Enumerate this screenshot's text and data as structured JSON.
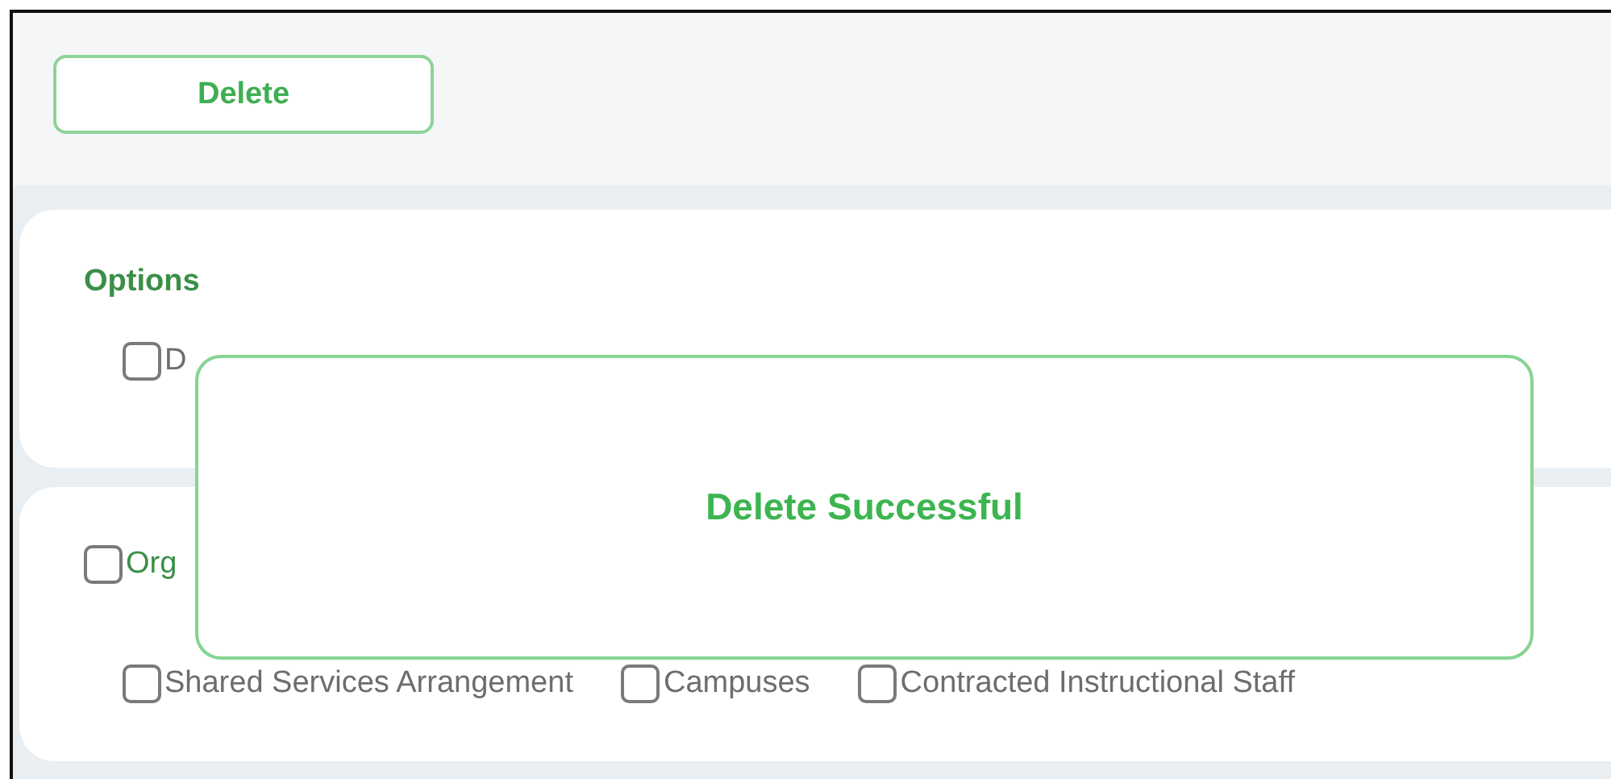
{
  "toolbar": {
    "delete_button": "Delete"
  },
  "options_panel": {
    "heading": "Options",
    "items": [
      {
        "label": "D",
        "checked": false
      }
    ]
  },
  "organization_panel": {
    "header": {
      "label": "Org",
      "checked": false
    },
    "items": [
      {
        "label": "Shared Services Arrangement",
        "checked": false
      },
      {
        "label": "Campuses",
        "checked": false
      },
      {
        "label": "Contracted Instructional Staff",
        "checked": false
      }
    ]
  },
  "dialog": {
    "message": "Delete Successful"
  }
}
